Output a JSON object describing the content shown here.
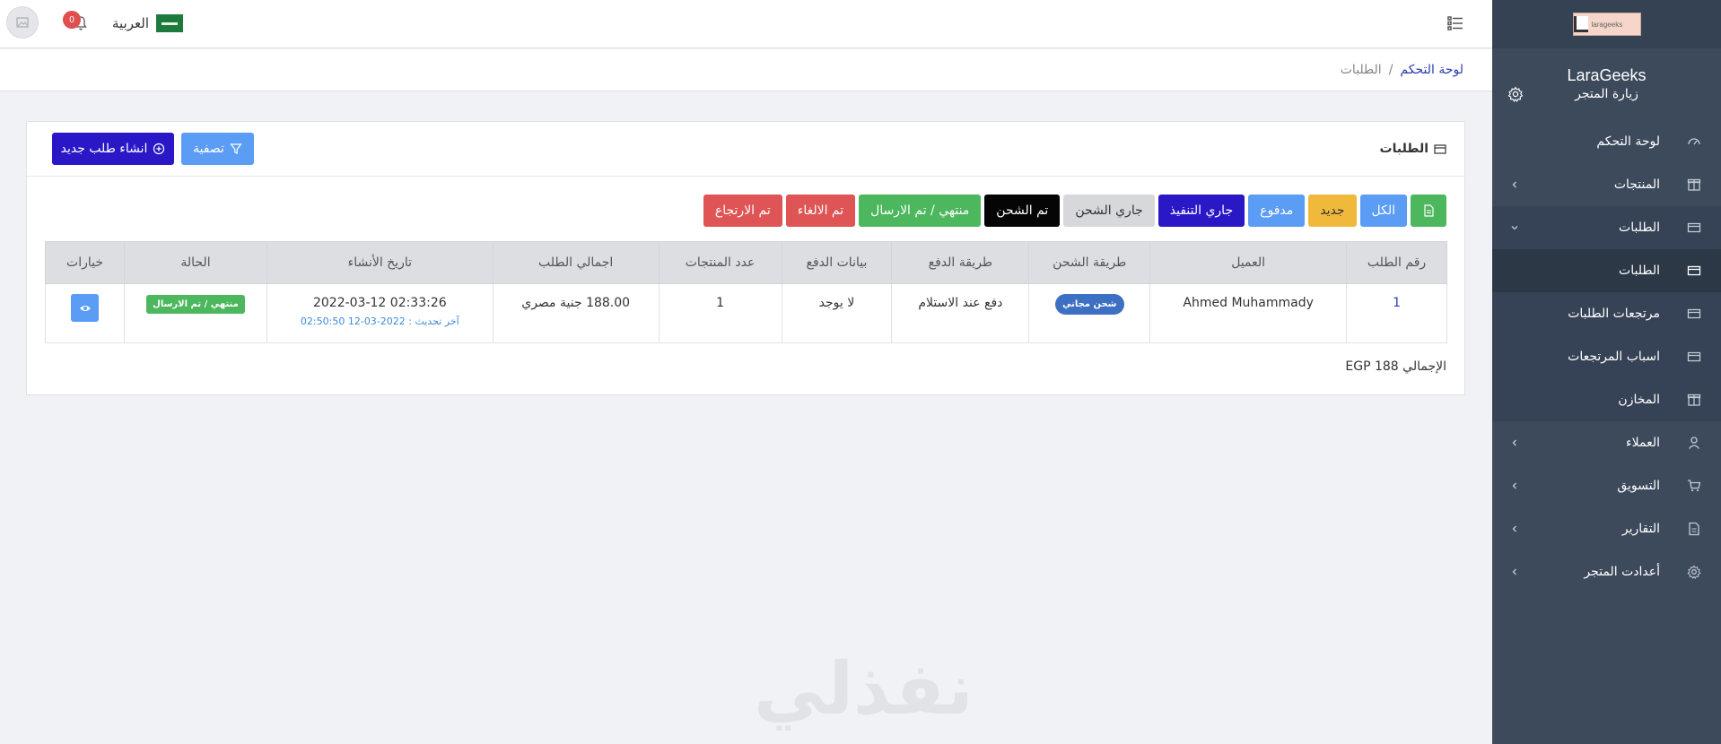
{
  "sidebar": {
    "logo_text": "larageeks",
    "brand_name": "LaraGeeks",
    "visit_store": "زيارة المتجر",
    "items": [
      {
        "label": "لوحة التحكم",
        "icon": "dashboard-icon"
      },
      {
        "label": "المنتجات",
        "icon": "box-icon"
      },
      {
        "label": "الطلبات",
        "icon": "card-icon"
      },
      {
        "label": "الطلبات",
        "icon": "card-icon"
      },
      {
        "label": "مرتجعات الطلبات",
        "icon": "card-icon"
      },
      {
        "label": "اسباب المرتجعات",
        "icon": "card-icon"
      },
      {
        "label": "المخازن",
        "icon": "box-icon"
      },
      {
        "label": "العملاء",
        "icon": "user-icon"
      },
      {
        "label": "التسويق",
        "icon": "cart-icon"
      },
      {
        "label": "التقارير",
        "icon": "report-icon"
      },
      {
        "label": "أعدادت المتجر",
        "icon": "gear-icon"
      }
    ]
  },
  "header": {
    "notifications_count": "0",
    "language": "العربية"
  },
  "breadcrumb": {
    "home": "لوحة التحكم",
    "separator": "/",
    "current": "الطلبات"
  },
  "card": {
    "title": "الطلبات",
    "new_order_label": "انشاء طلب جديد",
    "filter_label": "تصفية",
    "status_filters": [
      "الكل",
      "جديد",
      "مدفوع",
      "جاري التنفيذ",
      "جاري الشحن",
      "تم الشحن",
      "منتهي / تم الارسال",
      "تم الالغاء",
      "تم الارتجاع"
    ],
    "total_label": "الإجمالي EGP 188"
  },
  "table": {
    "columns": [
      "رقم الطلب",
      "العميل",
      "طريقة الشحن",
      "طريقة الدفع",
      "بيانات الدفع",
      "عدد المنتجات",
      "اجمالي الطلب",
      "تاريخ الأنشاء",
      "الحالة",
      "خيارات"
    ],
    "rows": [
      {
        "id": "1",
        "customer": "Ahmed Muhammady",
        "shipping": "شحن مجاني",
        "payment_method": "دفع عند الاستلام",
        "payment_data": "لا يوجد",
        "items_count": "1",
        "total": "188.00 جنية مصري",
        "created": "2022-03-12 02:33:26",
        "updated": "آخر تحديث : 2022-03-12 02:50:50",
        "status": "منتهي / تم الارسال"
      }
    ]
  },
  "watermark": "نفذلي",
  "colors": {
    "sidebar_bg": "#3d4a5c",
    "primary_dark": "#2a18c7",
    "primary_light": "#5b9cf4",
    "success": "#4cb75d",
    "warning": "#f0b93c",
    "danger": "#df5454"
  }
}
